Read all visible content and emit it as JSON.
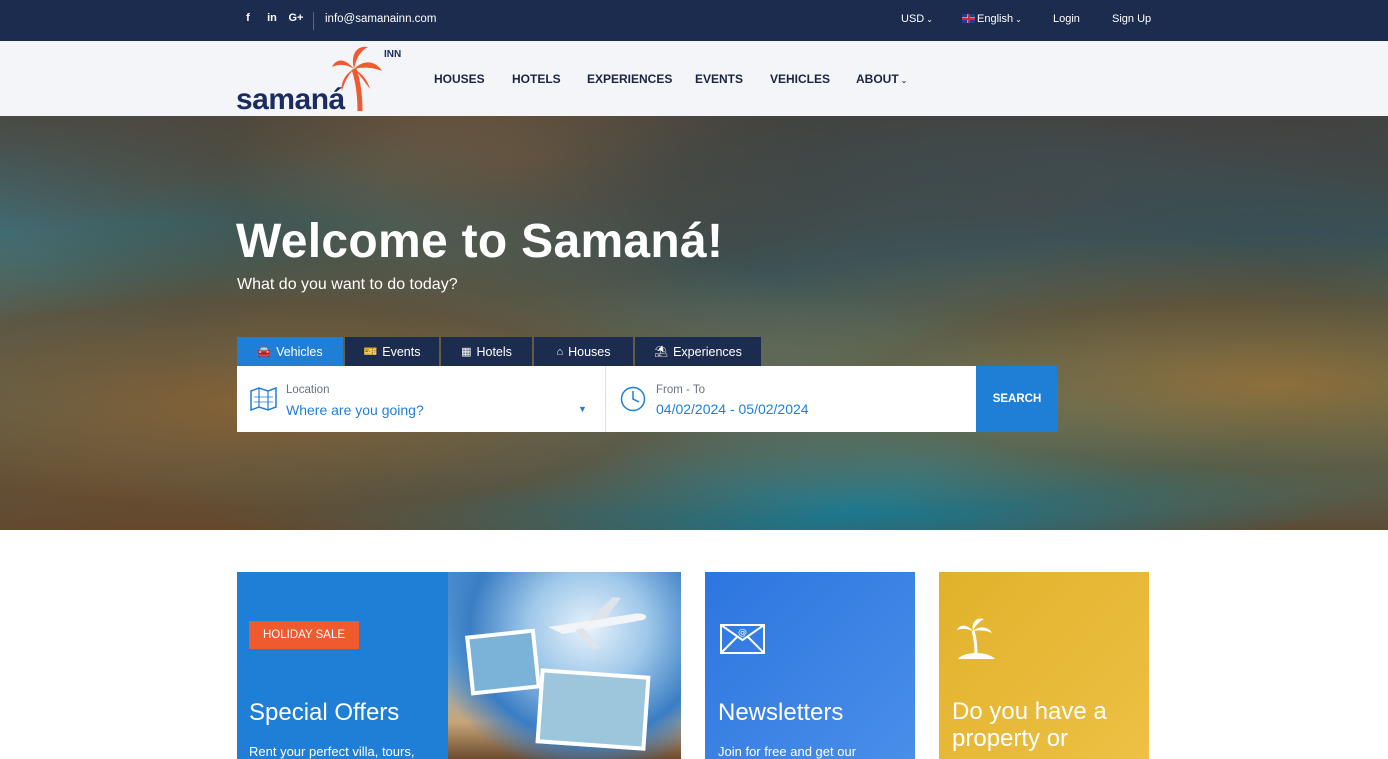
{
  "topbar": {
    "social": [
      "f",
      "in",
      "G+"
    ],
    "email": "info@samanainn.com",
    "currency": "USD",
    "language": "English",
    "login": "Login",
    "signup": "Sign Up"
  },
  "logo": {
    "word": "samaná",
    "inn": "INN"
  },
  "nav": [
    "HOUSES",
    "HOTELS",
    "EXPERIENCES",
    "EVENTS",
    "VEHICLES",
    "ABOUT"
  ],
  "hero": {
    "title": "Welcome to Samaná!",
    "subtitle": "What do you want to do today?"
  },
  "tabs": [
    {
      "label": "Vehicles",
      "icon": "car-icon",
      "active": true
    },
    {
      "label": "Events",
      "icon": "ticket-icon",
      "active": false
    },
    {
      "label": "Hotels",
      "icon": "building-icon",
      "active": false
    },
    {
      "label": "Houses",
      "icon": "house-icon",
      "active": false
    },
    {
      "label": "Experiences",
      "icon": "beach-umbrella-icon",
      "active": false
    }
  ],
  "search": {
    "location_label": "Location",
    "location_value": "Where are you going?",
    "date_label": "From - To",
    "date_value": "04/02/2024 - 05/02/2024",
    "button": "SEARCH"
  },
  "cards": {
    "offers": {
      "badge": "HOLIDAY SALE",
      "title": "Special Offers",
      "text": "Rent your perfect villa, tours,"
    },
    "newsletter": {
      "title": "Newsletters",
      "text": "Join for free and get our"
    },
    "property": {
      "title": "Do you have a property or"
    }
  },
  "colors": {
    "primary": "#1f7fd6",
    "navy": "#1c2c4e",
    "accent": "#ef5a2e",
    "yellow": "#e0b22a"
  }
}
